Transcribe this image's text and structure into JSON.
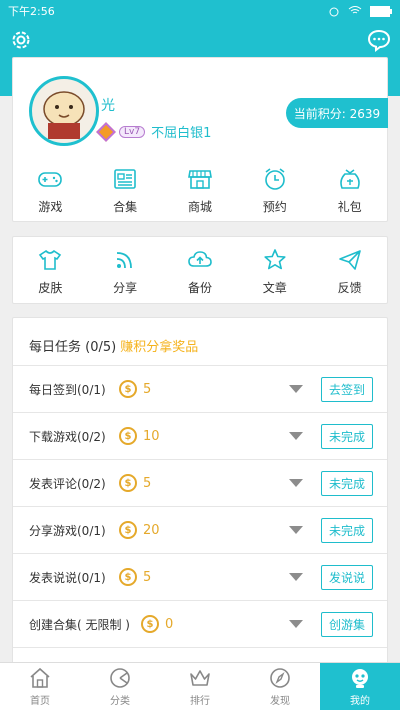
{
  "status_bar": {
    "time": "下午2:56"
  },
  "profile": {
    "username": "光",
    "level": "Lv7",
    "rank_title": "不屈白银1",
    "points_label": "当前积分: 2639"
  },
  "profile_menu": [
    {
      "label": "游戏",
      "icon": "gamepad-icon"
    },
    {
      "label": "合集",
      "icon": "collection-icon"
    },
    {
      "label": "商城",
      "icon": "store-icon"
    },
    {
      "label": "预约",
      "icon": "alarm-clock-icon"
    },
    {
      "label": "礼包",
      "icon": "gift-bag-icon"
    }
  ],
  "tools_menu": [
    {
      "label": "皮肤",
      "icon": "tshirt-icon"
    },
    {
      "label": "分享",
      "icon": "rss-icon"
    },
    {
      "label": "备份",
      "icon": "cloud-upload-icon"
    },
    {
      "label": "文章",
      "icon": "star-icon"
    },
    {
      "label": "反馈",
      "icon": "paper-plane-icon"
    }
  ],
  "daily_tasks": {
    "title": "每日任务 (0/5)",
    "promo": "赚积分拿奖品",
    "items": [
      {
        "name": "每日签到(0/1)",
        "reward": "5",
        "action": "去签到"
      },
      {
        "name": "下载游戏(0/2)",
        "reward": "10",
        "action": "未完成"
      },
      {
        "name": "发表评论(0/2)",
        "reward": "5",
        "action": "未完成"
      },
      {
        "name": "分享游戏(0/1)",
        "reward": "20",
        "action": "未完成"
      },
      {
        "name": "发表说说(0/1)",
        "reward": "5",
        "action": "发说说"
      },
      {
        "name": "创建合集( 无限制 )",
        "reward": "0",
        "action": "创游集"
      }
    ]
  },
  "tabbar": [
    {
      "label": "首页",
      "icon": "home-icon"
    },
    {
      "label": "分类",
      "icon": "category-icon"
    },
    {
      "label": "排行",
      "icon": "crown-icon"
    },
    {
      "label": "发现",
      "icon": "compass-icon"
    },
    {
      "label": "我的",
      "icon": "profile-icon",
      "active": true
    }
  ],
  "colors": {
    "accent": "#1fc0cf",
    "coin": "#e5a92b",
    "promo": "#f5b21b"
  }
}
